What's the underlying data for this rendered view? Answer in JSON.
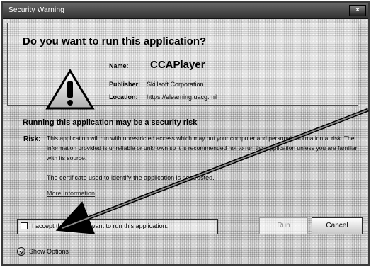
{
  "window": {
    "title": "Security Warning",
    "close_label": "×"
  },
  "question": "Do you want to run this application?",
  "app_info": {
    "name_label": "Name:",
    "name": "CCAPlayer",
    "publisher_label": "Publisher:",
    "publisher": "Skillsoft Corporation",
    "location_label": "Location:",
    "location": "https://elearning.uacg.mil"
  },
  "risk": {
    "header": "Running this application may be a security risk",
    "label": "Risk:",
    "text": "This application will run with unrestricted access which may put your computer and personal information at risk. The information provided is unreliable or unknown so it is recommended not to run this application unless you are familiar with its source.",
    "certificate_text": "The certificate used to identify the application is not trusted.",
    "more_info_label": "More Information"
  },
  "accept": {
    "checkbox_checked": false,
    "label": "I accept the risk and want to run this application."
  },
  "buttons": {
    "run": "Run",
    "cancel": "Cancel",
    "options": "Show Options"
  }
}
